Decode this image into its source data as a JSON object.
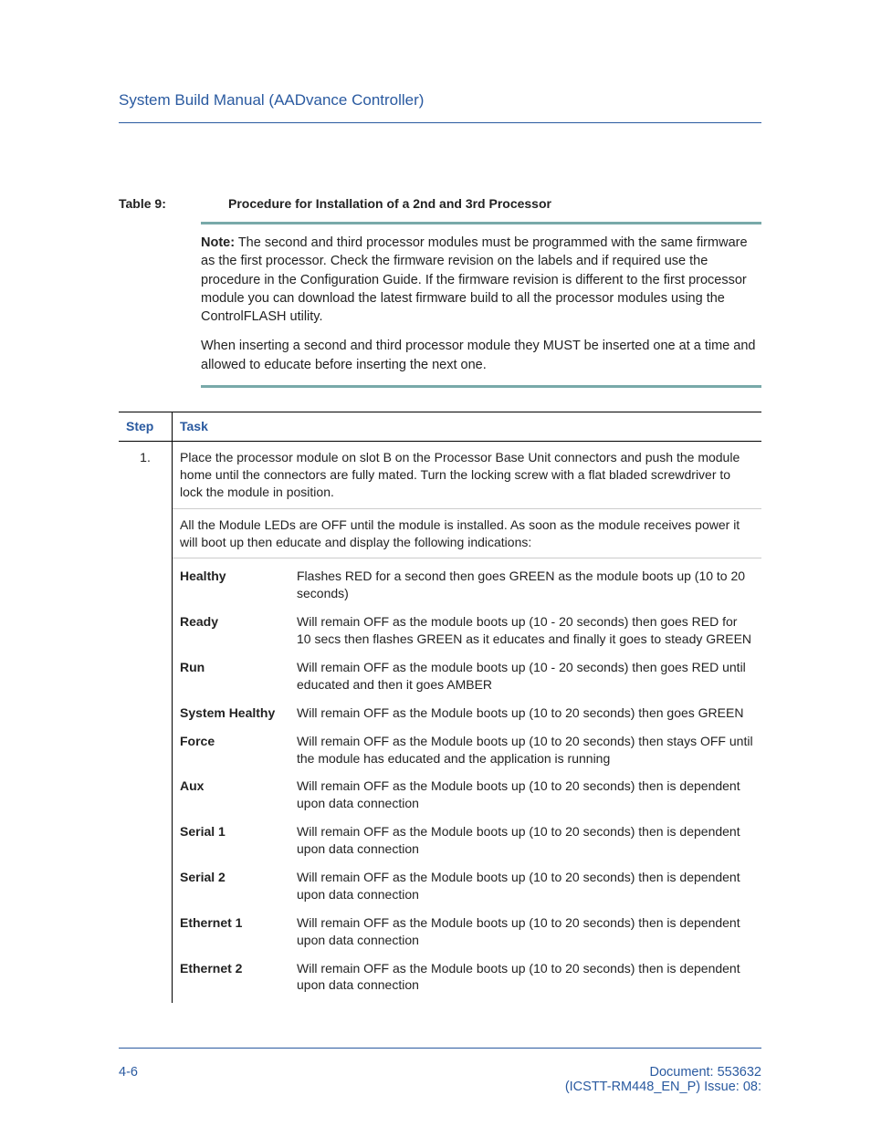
{
  "header": {
    "title": "System Build Manual  (AADvance Controller)"
  },
  "table": {
    "label": "Table 9:",
    "caption": "Procedure for Installation of a 2nd and 3rd Processor"
  },
  "note": {
    "label": "Note:",
    "p1_rest": " The second and third processor modules must be programmed with the same firmware as the first processor. Check the firmware revision on the labels and if required use the procedure in the Configuration Guide. If the firmware revision is different to the first processor module you can download the latest firmware build to all the processor modules using the ControlFLASH utility.",
    "p2": "When inserting a second and third processor module they MUST be inserted one at a time and allowed to educate before inserting the next one."
  },
  "columns": {
    "step": "Step",
    "task": "Task"
  },
  "step1": {
    "num": "1.",
    "task_a": "Place the processor module on slot B on the Processor Base Unit connectors and push the module home until the connectors are fully mated. Turn the locking screw with a flat bladed screwdriver to lock the module in position.",
    "task_b": "All the Module LEDs are OFF until the module is installed. As soon as the module receives power it will boot up then educate and display the following indications:"
  },
  "leds": [
    {
      "name": "Healthy",
      "desc": "Flashes RED for a second then goes GREEN as the module boots up (10 to 20 seconds)"
    },
    {
      "name": "Ready",
      "desc": "Will remain OFF as the module boots up (10 - 20 seconds) then goes RED for 10 secs then flashes GREEN as it educates and finally it goes to steady GREEN"
    },
    {
      "name": "Run",
      "desc": "Will remain OFF as the module boots up (10 - 20 seconds) then goes RED until educated and then it goes AMBER"
    },
    {
      "name": "System Healthy",
      "desc": "Will remain OFF as the Module boots up (10 to 20 seconds) then goes GREEN"
    },
    {
      "name": "Force",
      "desc": "Will remain OFF as the Module boots up (10 to 20 seconds) then stays OFF until the module has educated and the application is running"
    },
    {
      "name": "Aux",
      "desc": "Will remain OFF as the Module boots up (10 to 20 seconds) then is dependent upon data connection"
    },
    {
      "name": "Serial 1",
      "desc": "Will remain OFF as the Module boots up (10 to 20 seconds) then is dependent upon data connection"
    },
    {
      "name": "Serial 2",
      "desc": "Will remain OFF as the Module boots up (10 to 20 seconds) then is dependent upon data connection"
    },
    {
      "name": "Ethernet 1",
      "desc": "Will remain OFF as the Module boots up (10 to 20 seconds) then is dependent upon data connection"
    },
    {
      "name": "Ethernet 2",
      "desc": "Will remain OFF as the Module boots up (10 to 20 seconds) then is dependent upon data connection"
    }
  ],
  "footer": {
    "page": "4-6",
    "doc_line1": "Document: 553632",
    "doc_line2": "(ICSTT-RM448_EN_P) Issue: 08:"
  }
}
